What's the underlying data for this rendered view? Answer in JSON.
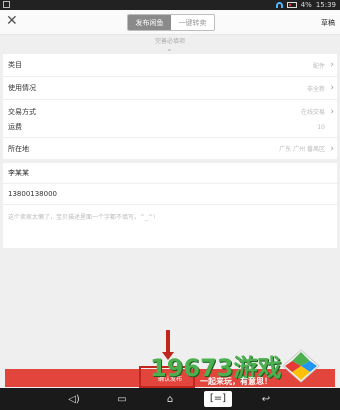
{
  "status_bar": {
    "time": "15:39",
    "battery": "4%"
  },
  "topbar": {
    "tabs": [
      {
        "label": "发布闲鱼",
        "active": true
      },
      {
        "label": "一键转卖",
        "active": false
      }
    ],
    "draft_label": "草稿"
  },
  "hint": "完善必填项",
  "section1": [
    {
      "label": "类目",
      "value": "配件"
    },
    {
      "label": "使用情况",
      "value": "非全新"
    },
    {
      "label": "交易方式",
      "value": "在线交易"
    }
  ],
  "section2": [
    {
      "label": "运费",
      "value": "10"
    },
    {
      "label": "所在地",
      "value": "广东 广州 番禺区"
    }
  ],
  "contact": {
    "name": "李某某",
    "phone": "13800138000",
    "description_placeholder": "这个卖家太懒了，宝贝描述里面一个字都不填写。^_^!"
  },
  "submit_label": "确认发布",
  "navbar": [
    "back",
    "home",
    "recent",
    "screenshot",
    "menu"
  ],
  "watermark": {
    "brand": "19673游戏",
    "slogan": "一起来玩，有意思！"
  },
  "colors": {
    "accent": "#e2453c",
    "tab_active": "#8a8a8a",
    "annotation": "#c0261d",
    "watermark": "#4caf50"
  }
}
